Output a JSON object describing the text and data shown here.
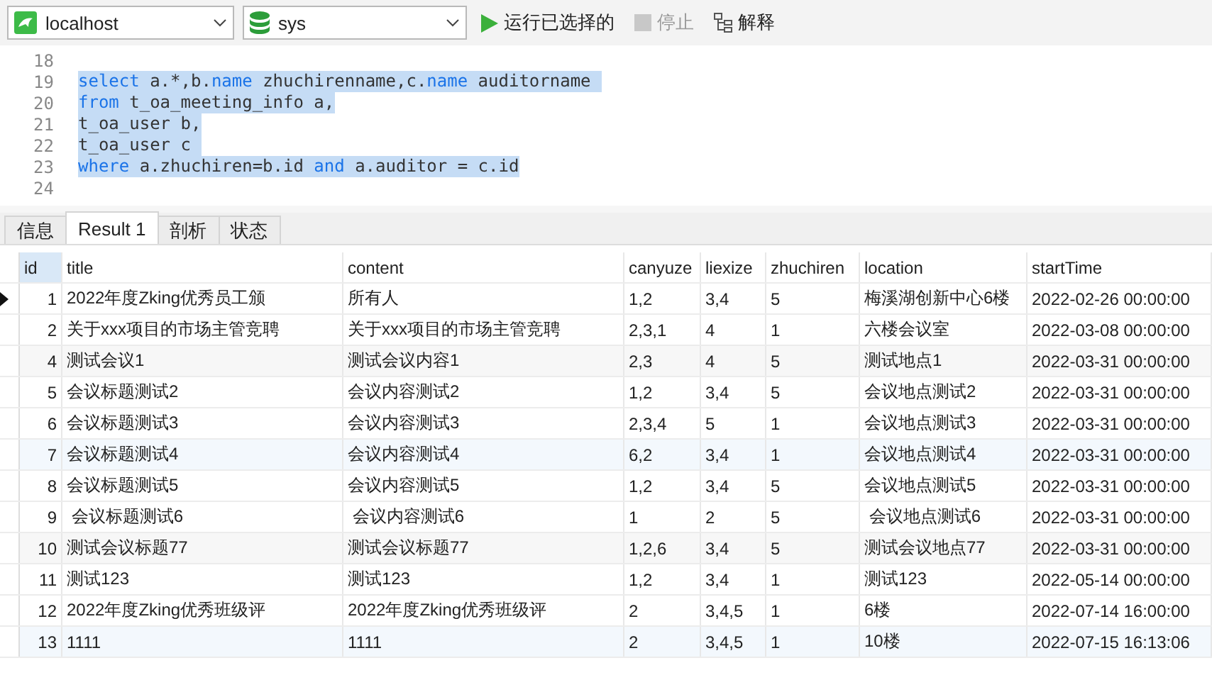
{
  "toolbar": {
    "connection": "localhost",
    "database": "sys",
    "buttons": [
      {
        "kind": "run",
        "label": "运行已选择的",
        "disabled": false
      },
      {
        "kind": "stop",
        "label": "停止",
        "disabled": true
      },
      {
        "kind": "explain",
        "label": "解释",
        "disabled": false
      }
    ]
  },
  "editor": {
    "lines": [
      {
        "number": "18",
        "selected": false
      },
      {
        "number": "19",
        "selected": true,
        "tokens": [
          {
            "kind": "keyword",
            "text": "select"
          },
          {
            "kind": "plain",
            "text": " a.*,b."
          },
          {
            "kind": "keyword",
            "text": "name"
          },
          {
            "kind": "plain",
            "text": " zhuchirenname,c."
          },
          {
            "kind": "keyword",
            "text": "name"
          },
          {
            "kind": "plain",
            "text": " auditorname "
          }
        ]
      },
      {
        "number": "20",
        "selected": true,
        "tokens": [
          {
            "kind": "keyword",
            "text": "from"
          },
          {
            "kind": "plain",
            "text": " t_oa_meeting_info a,"
          }
        ]
      },
      {
        "number": "21",
        "selected": true,
        "tokens": [
          {
            "kind": "plain",
            "text": "t_oa_user b,"
          }
        ]
      },
      {
        "number": "22",
        "selected": true,
        "tokens": [
          {
            "kind": "plain",
            "text": "t_oa_user c "
          }
        ]
      },
      {
        "number": "23",
        "selected": true,
        "tokens": [
          {
            "kind": "keyword",
            "text": "where"
          },
          {
            "kind": "plain",
            "text": " a.zhuchiren=b.id "
          },
          {
            "kind": "keyword",
            "text": "and"
          },
          {
            "kind": "plain",
            "text": " a.auditor = c.id"
          }
        ]
      },
      {
        "number": "24",
        "selected": false
      }
    ]
  },
  "tabs": [
    {
      "label": "信息",
      "selected": false
    },
    {
      "label": "Result 1",
      "selected": true
    },
    {
      "label": "剖析",
      "selected": false
    },
    {
      "label": "状态",
      "selected": false
    }
  ],
  "table": {
    "columns": [
      "id",
      "title",
      "content",
      "canyuze",
      "liexize",
      "zhuchiren",
      "location",
      "startTime"
    ],
    "rows": [
      {
        "current": true,
        "shaded": false,
        "highlighted": false,
        "cells": [
          "1",
          "2022年度Zking优秀员工颁",
          "所有人",
          "1,2",
          "3,4",
          "5",
          "梅溪湖创新中心6楼",
          "2022-02-26 00:00:00"
        ]
      },
      {
        "current": false,
        "shaded": false,
        "highlighted": false,
        "cells": [
          "2",
          "关于xxx项目的市场主管竞聘",
          "关于xxx项目的市场主管竞聘",
          "2,3,1",
          "4",
          "1",
          "六楼会议室",
          "2022-03-08 00:00:00"
        ]
      },
      {
        "current": false,
        "shaded": true,
        "highlighted": false,
        "cells": [
          "4",
          "测试会议1",
          "测试会议内容1",
          "2,3",
          "4",
          "5",
          "测试地点1",
          "2022-03-31 00:00:00"
        ]
      },
      {
        "current": false,
        "shaded": false,
        "highlighted": false,
        "cells": [
          "5",
          "会议标题测试2",
          "会议内容测试2",
          "1,2",
          "3,4",
          "5",
          "会议地点测试2",
          "2022-03-31 00:00:00"
        ]
      },
      {
        "current": false,
        "shaded": false,
        "highlighted": false,
        "cells": [
          "6",
          "会议标题测试3",
          "会议内容测试3",
          "2,3,4",
          "5",
          "1",
          "会议地点测试3",
          "2022-03-31 00:00:00"
        ]
      },
      {
        "current": false,
        "shaded": false,
        "highlighted": true,
        "cells": [
          "7",
          "会议标题测试4",
          "会议内容测试4",
          "6,2",
          "3,4",
          "1",
          "会议地点测试4",
          "2022-03-31 00:00:00"
        ]
      },
      {
        "current": false,
        "shaded": false,
        "highlighted": false,
        "cells": [
          "8",
          "会议标题测试5",
          "会议内容测试5",
          "1,2",
          "3,4",
          "5",
          "会议地点测试5",
          "2022-03-31 00:00:00"
        ]
      },
      {
        "current": false,
        "shaded": false,
        "highlighted": false,
        "cells": [
          "9",
          " 会议标题测试6",
          " 会议内容测试6",
          "1",
          "2",
          "5",
          " 会议地点测试6",
          "2022-03-31 00:00:00"
        ]
      },
      {
        "current": false,
        "shaded": true,
        "highlighted": false,
        "cells": [
          "10",
          "测试会议标题77",
          "测试会议标题77",
          "1,2,6",
          "3,4",
          "5",
          "测试会议地点77",
          "2022-03-31 00:00:00"
        ]
      },
      {
        "current": false,
        "shaded": false,
        "highlighted": false,
        "cells": [
          "11",
          "测试123",
          "测试123",
          "1,2",
          "3,4",
          "1",
          "测试123",
          "2022-05-14 00:00:00"
        ]
      },
      {
        "current": false,
        "shaded": false,
        "highlighted": false,
        "cells": [
          "12",
          "2022年度Zking优秀班级评",
          "2022年度Zking优秀班级评",
          "2",
          "3,4,5",
          "1",
          "6楼",
          "2022-07-14 16:00:00"
        ]
      },
      {
        "current": false,
        "shaded": false,
        "highlighted": true,
        "cells": [
          "13",
          "1111",
          "1111",
          "2",
          "3,4,5",
          "1",
          "10楼",
          "2022-07-15 16:13:06"
        ]
      }
    ]
  }
}
